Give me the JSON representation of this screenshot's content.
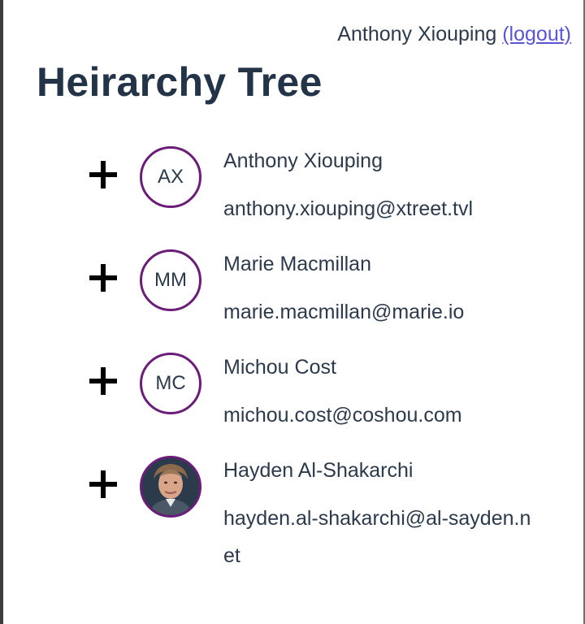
{
  "header": {
    "user_name": "Anthony Xiouping",
    "logout_label": "(logout)"
  },
  "page": {
    "title": "Heirarchy Tree"
  },
  "people": [
    {
      "initials": "AX",
      "name": "Anthony Xiouping",
      "email": "anthony.xiouping@xtreet.tvl"
    },
    {
      "initials": "MM",
      "name": "Marie Macmillan",
      "email": "marie.macmillan@marie.io"
    },
    {
      "initials": "MC",
      "name": "Michou Cost",
      "email": "michou.cost@coshou.com"
    },
    {
      "initials": "",
      "name": "Hayden Al-Shakarchi",
      "email": "hayden.al-shakarchi@al-sayden.net",
      "avatar": "photo"
    }
  ],
  "icons": {
    "expand": "plus-icon"
  },
  "colors": {
    "text": "#2c3a4b",
    "title": "#233448",
    "link": "#5a55d6",
    "avatar_ring": "#6b1e78"
  }
}
